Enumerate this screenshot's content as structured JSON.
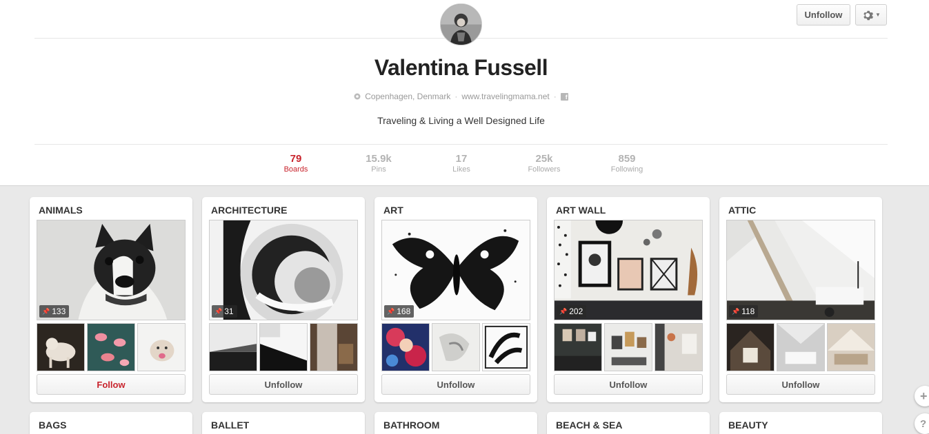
{
  "header": {
    "unfollow_label": "Unfollow",
    "settings_icon": "gear-icon",
    "name": "Valentina Fussell",
    "location": "Copenhagen, Denmark",
    "website": "www.travelingmama.net",
    "about": "Traveling & Living a Well Designed Life"
  },
  "stats": [
    {
      "num": "79",
      "label": "Boards",
      "active": true
    },
    {
      "num": "15.9k",
      "label": "Pins"
    },
    {
      "num": "17",
      "label": "Likes"
    },
    {
      "num": "25k",
      "label": "Followers"
    },
    {
      "num": "859",
      "label": "Following"
    }
  ],
  "boards": [
    {
      "title": "ANIMALS",
      "pins": "133",
      "button": "Follow"
    },
    {
      "title": "ARCHITECTURE",
      "pins": "31",
      "button": "Unfollow"
    },
    {
      "title": "ART",
      "pins": "168",
      "button": "Unfollow"
    },
    {
      "title": "ART WALL",
      "pins": "202",
      "button": "Unfollow"
    },
    {
      "title": "ATTIC",
      "pins": "118",
      "button": "Unfollow"
    }
  ],
  "boards_row2": [
    {
      "title": "BAGS"
    },
    {
      "title": "BALLET"
    },
    {
      "title": "BATHROOM"
    },
    {
      "title": "BEACH & SEA"
    },
    {
      "title": "BEAUTY"
    }
  ],
  "side": {
    "add_icon": "plus-icon",
    "help_label": "?"
  },
  "colors": {
    "accent": "#c8232c",
    "background": "#e9e9e9"
  }
}
